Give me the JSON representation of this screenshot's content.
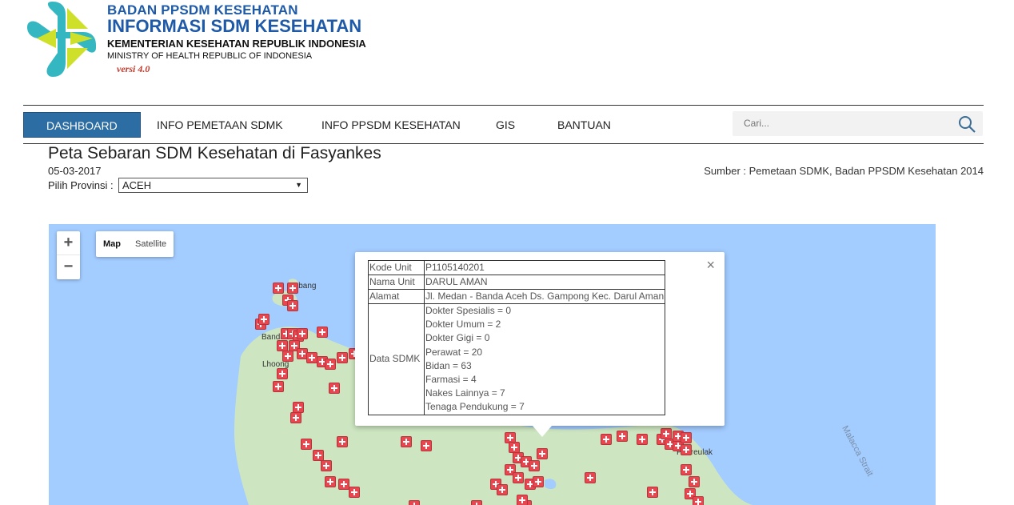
{
  "header": {
    "line1": "BADAN PPSDM KESEHATAN",
    "line2": "INFORMASI SDM KESEHATAN",
    "line3": "KEMENTERIAN KESEHATAN REPUBLIK INDONESIA",
    "line4": "MINISTRY OF HEALTH REPUBLIC OF INDONESIA",
    "version": "versi 4.0"
  },
  "nav": {
    "items": [
      "DASHBOARD",
      "INFO PEMETAAN SDMK",
      "INFO PPSDM KESEHATAN",
      "GIS",
      "BANTUAN"
    ],
    "active": "DASHBOARD",
    "search_placeholder": "Cari..."
  },
  "page": {
    "title": "Peta Sebaran SDM Kesehatan di Fasyankes",
    "date": "05-03-2017",
    "source": "Sumber : Pemetaan SDMK, Badan PPSDM Kesehatan 2014",
    "province_label": "Pilih Provinsi :",
    "province_value": "ACEH"
  },
  "map": {
    "zoom_in": "+",
    "zoom_out": "−",
    "type_map": "Map",
    "type_satellite": "Satellite",
    "selected_type": "Map",
    "labels": {
      "banda_aceh": "Banda Aceh",
      "lhoong": "Lhoong",
      "peureulak": "Peureulak",
      "malacca_strait": "Malacca Strait",
      "sabang": "Sabang"
    },
    "colors": {
      "water": "#a3ccff",
      "land": "#cde6c1",
      "marker": "#e8474f"
    }
  },
  "popup": {
    "close": "×",
    "rows": {
      "kode_unit_label": "Kode Unit",
      "kode_unit_value": "P1105140201",
      "nama_unit_label": "Nama Unit",
      "nama_unit_value": "DARUL AMAN",
      "alamat_label": "Alamat",
      "alamat_value": "Jl. Medan - Banda Aceh Ds. Gampong Kec. Darul Aman",
      "data_label": "Data SDMK"
    },
    "sdmk": [
      "Dokter Spesialis = 0",
      "Dokter Umum = 2",
      "Dokter Gigi = 0",
      "Perawat = 20",
      "Bidan = 63",
      "Farmasi = 4",
      "Nakes Lainnya = 7",
      "Tenaga Pendukung = 7"
    ]
  }
}
